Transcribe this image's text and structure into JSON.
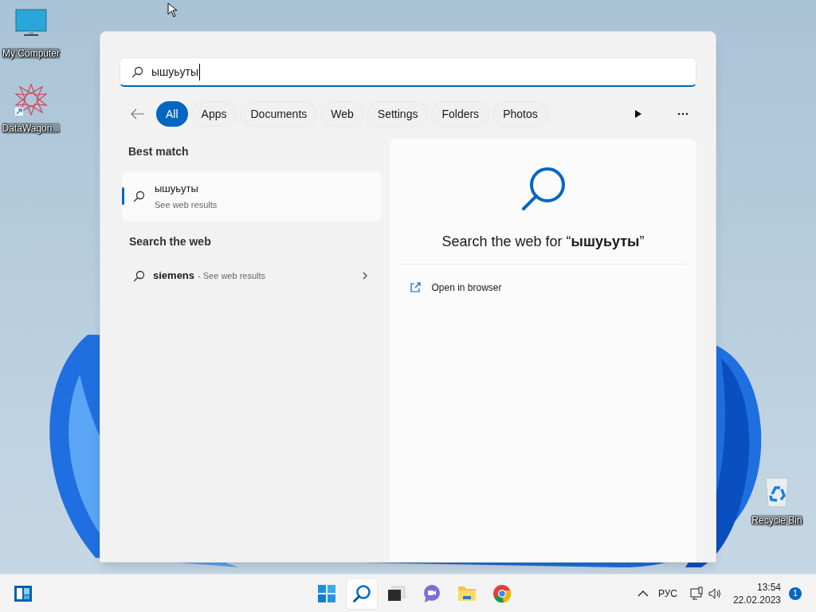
{
  "desktop_icons": [
    {
      "kind": "computer",
      "label": "My Computer"
    },
    {
      "kind": "app",
      "label": "DataWagon..."
    },
    {
      "kind": "recycle",
      "label": "Recycle Bin"
    }
  ],
  "search": {
    "query": "ышуьуты",
    "filters": [
      {
        "label": "All",
        "selected": true
      },
      {
        "label": "Apps",
        "selected": false
      },
      {
        "label": "Documents",
        "selected": false
      },
      {
        "label": "Web",
        "selected": false
      },
      {
        "label": "Settings",
        "selected": false
      },
      {
        "label": "Folders",
        "selected": false
      },
      {
        "label": "Photos",
        "selected": false
      }
    ],
    "best_match": {
      "heading": "Best match",
      "title": "ышуьуты",
      "subtitle": "See web results",
      "selected": true
    },
    "web": {
      "heading": "Search the web",
      "items": [
        {
          "term": "siemens",
          "suffix": "- See web results"
        }
      ]
    },
    "preview": {
      "heading": "Search the web for “**ышуьуты**”",
      "actions": [
        "Open in browser"
      ]
    }
  },
  "taskbar": {
    "apps": [
      {
        "kind": "start",
        "selected": false
      },
      {
        "kind": "search",
        "selected": true
      },
      {
        "kind": "taskview",
        "selected": false
      },
      {
        "kind": "chat",
        "selected": false
      },
      {
        "kind": "explorer",
        "selected": false
      },
      {
        "kind": "chrome",
        "selected": false
      }
    ],
    "tray": {
      "language": "РУС",
      "time": "13:54",
      "date": "22.02.2023",
      "badge": "1"
    }
  }
}
